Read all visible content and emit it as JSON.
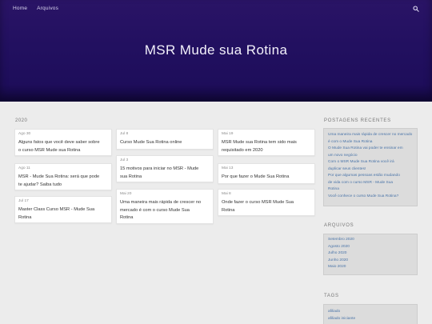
{
  "nav": {
    "home": "Home",
    "archives": "Arquivos"
  },
  "site_title": "MSR Mude sua Rotina",
  "year_heading": "2020",
  "posts": [
    {
      "date": "Ago 30",
      "title_lines": [
        "Alguns fatos que você deve saber sobre",
        "o curso MSR Mude sua Rotina"
      ]
    },
    {
      "date": "Jul 8",
      "title_lines": [
        "Curso Mude Sua Rotina online"
      ]
    },
    {
      "date": "Mai 19",
      "title_lines": [
        "MSR Mude sua Rotina tem sido mais",
        "requisitado em 2020"
      ]
    },
    {
      "date": "Ago 11",
      "title_lines": [
        "MSR - Mude Sua Rotina: será que pode",
        "te ajudar? Saiba tudo"
      ]
    },
    {
      "date": "Jul 3",
      "title_lines": [
        "15 motivos para iniciar no MSR - Mude",
        "sua Rotina"
      ]
    },
    {
      "date": "Mai 13",
      "title_lines": [
        "Por que fazer o Mude Sua Rotina"
      ]
    },
    {
      "date": "Jul 17",
      "title_lines": [
        "Master Class Curso MSR - Mude Sua",
        "Rotina"
      ]
    },
    {
      "date": "Mai 20",
      "title_lines": [
        "Uma maneira mais rápida de crescer no",
        "mercado é com o curso Mude Sua",
        "Rotina"
      ]
    },
    {
      "date": "Mai 8",
      "title_lines": [
        "Onde fazer o curso MSR Mude Sua",
        "Rotina"
      ]
    }
  ],
  "sidebar": {
    "recent_heading": "POSTAGENS RECENTES",
    "recent_lines": [
      "Uma maneira mais rápida de crescer no mercado",
      "é com o Mude Sua Rotina",
      "O Mude Sua Rotina vai poder te ensinar em",
      "um novo negócio",
      "Com o MSR Mude Sua Rotina você irá",
      "duplicar seus clientes!",
      "Por que algumas pessoas estão mudando",
      "de vida com o curso MSR - Mude Sua",
      "Rotina",
      "Você conhece o curso Mude Sua Rotina?"
    ],
    "archives_heading": "ARQUIVOS",
    "archives": [
      "Setembro 2020",
      "Agosto 2020",
      "Julho 2020",
      "Junho 2020",
      "Maio 2020"
    ],
    "tags_heading": "TAGS",
    "tags": [
      "afiliado",
      "afiliado iniciante"
    ]
  },
  "colors": {
    "header": "#221060",
    "link": "#4a74a8",
    "page_bg": "#ececec"
  }
}
